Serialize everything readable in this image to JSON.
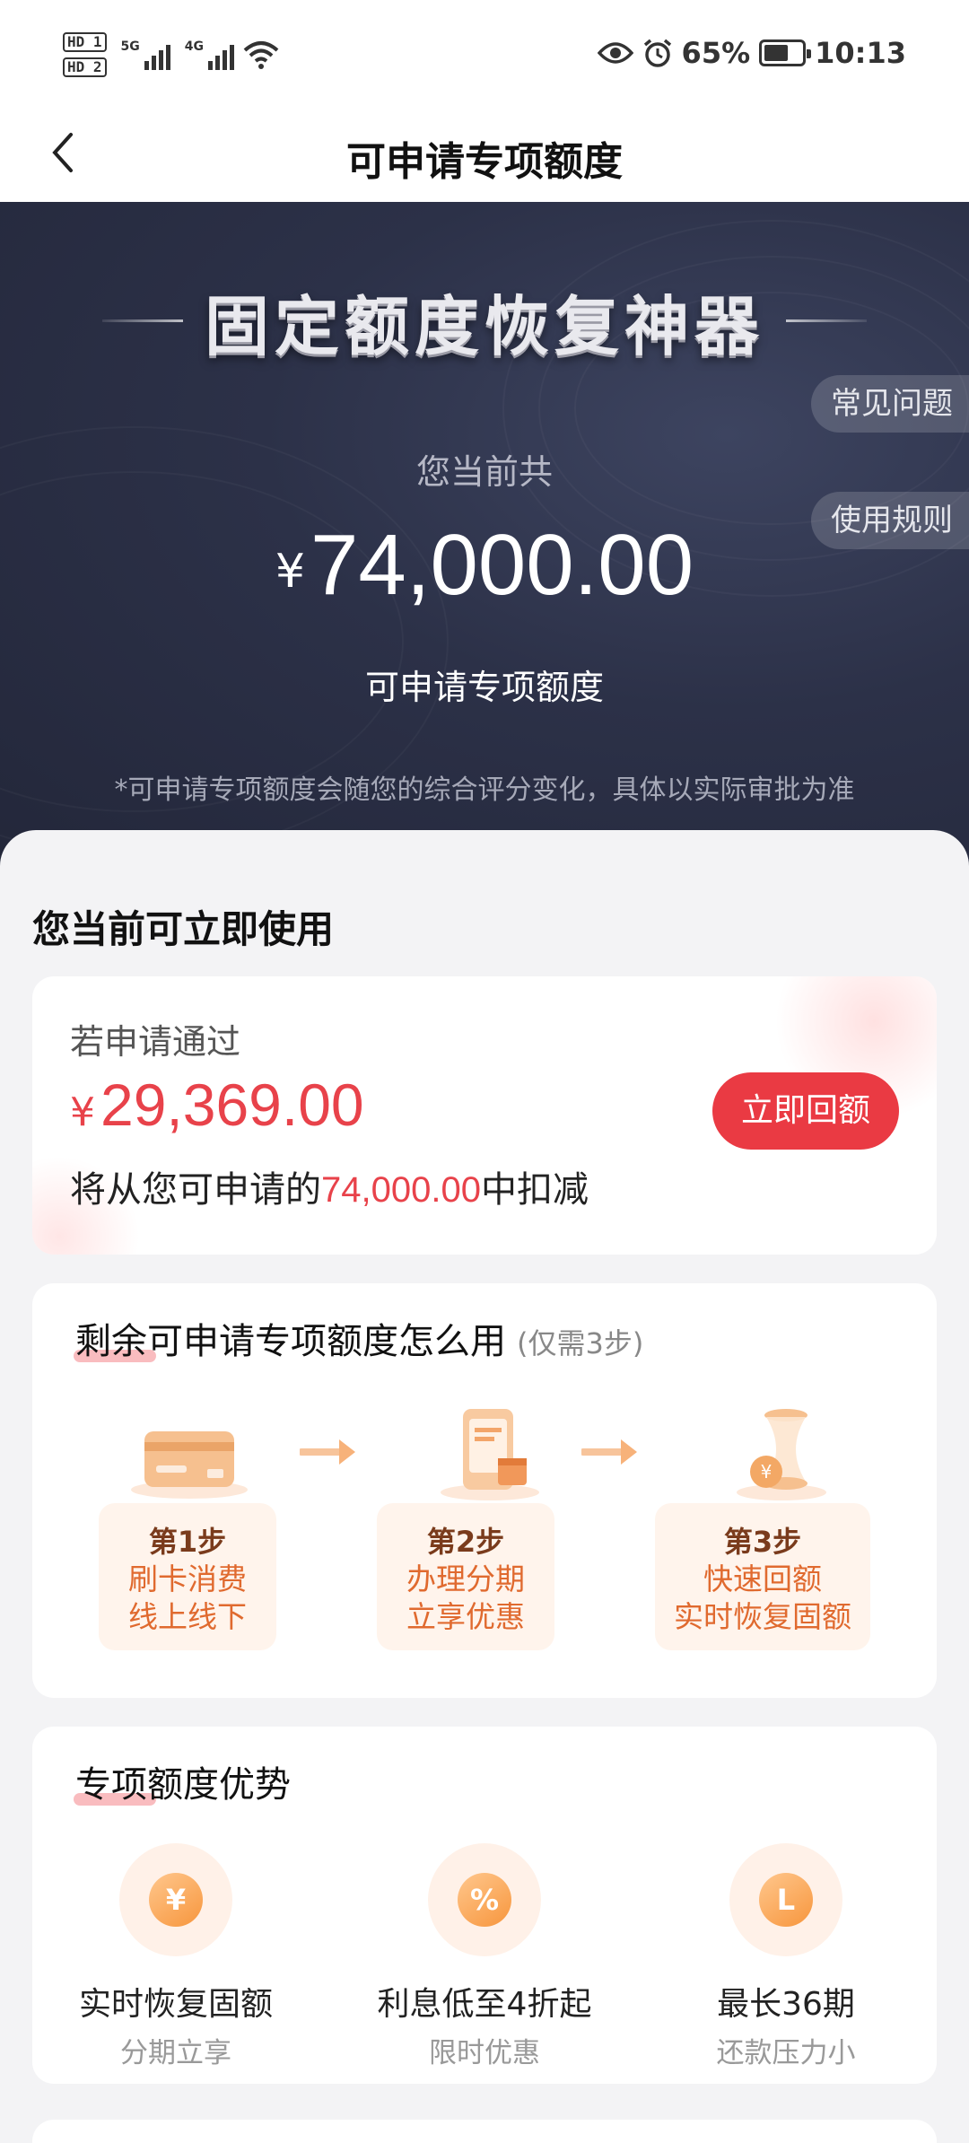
{
  "status_bar": {
    "hd1": "HD 1",
    "hd2": "HD 2",
    "net1": "5G",
    "net2": "4G",
    "battery": "65%",
    "battery_level": 0.65,
    "time": "10:13"
  },
  "nav": {
    "title": "可申请专项额度"
  },
  "hero": {
    "title": "固定额度恢复神器",
    "faq": "常见问题",
    "rules": "使用规则",
    "subtitle": "您当前共",
    "currency": "¥",
    "amount": "74,000.00",
    "amount_label": "可申请专项额度",
    "note": "*可申请专项额度会随您的综合评分变化，具体以实际审批为准"
  },
  "available": {
    "heading": "您当前可立即使用",
    "label": "若申请通过",
    "currency": "¥",
    "amount": "29,369.00",
    "desc_prefix": "将从您可申请的",
    "desc_amount": "74,000.00",
    "desc_suffix": "中扣减",
    "button": "立即回额"
  },
  "howto": {
    "title_highlight": "剩余可申请专项额度怎么用",
    "title_sub": "(仅需3步)",
    "steps": [
      {
        "num": "第1步",
        "line1": "刷卡消费",
        "line2": "线上线下",
        "icon": "card-icon"
      },
      {
        "num": "第2步",
        "line1": "办理分期",
        "line2": "立享优惠",
        "icon": "phone-calendar-icon"
      },
      {
        "num": "第3步",
        "line1": "快速回额",
        "line2": "实时恢复固额",
        "icon": "coin-hourglass-icon"
      }
    ]
  },
  "advantages": {
    "title": "专项额度优势",
    "items": [
      {
        "glyph": "¥",
        "main": "实时恢复固额",
        "sub": "分期立享",
        "icon": "yen-icon"
      },
      {
        "glyph": "%",
        "main": "利息低至4折起",
        "sub": "限时优惠",
        "icon": "coupon-icon"
      },
      {
        "glyph": "L",
        "main": "最长36期",
        "sub": "还款压力小",
        "icon": "clock-icon"
      }
    ]
  },
  "colors": {
    "accent_red": "#ea3a43",
    "hero_bg": "#2c3148",
    "step_orange": "#e06a2f"
  }
}
